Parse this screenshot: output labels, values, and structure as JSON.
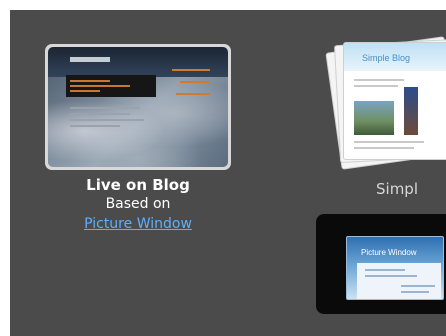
{
  "templates": {
    "live": {
      "name": "Live on Blog",
      "based_on_label": "Based on",
      "base_template": "Picture Window"
    },
    "simple": {
      "label": "Simpl",
      "thumb_title": "Simple Blog"
    },
    "picture_window": {
      "thumb_title": "Picture Window",
      "selected": true
    }
  },
  "colors": {
    "panel": "#4b4b4b",
    "link": "#5cb0ff",
    "selected_card": "#0a0a0a"
  }
}
